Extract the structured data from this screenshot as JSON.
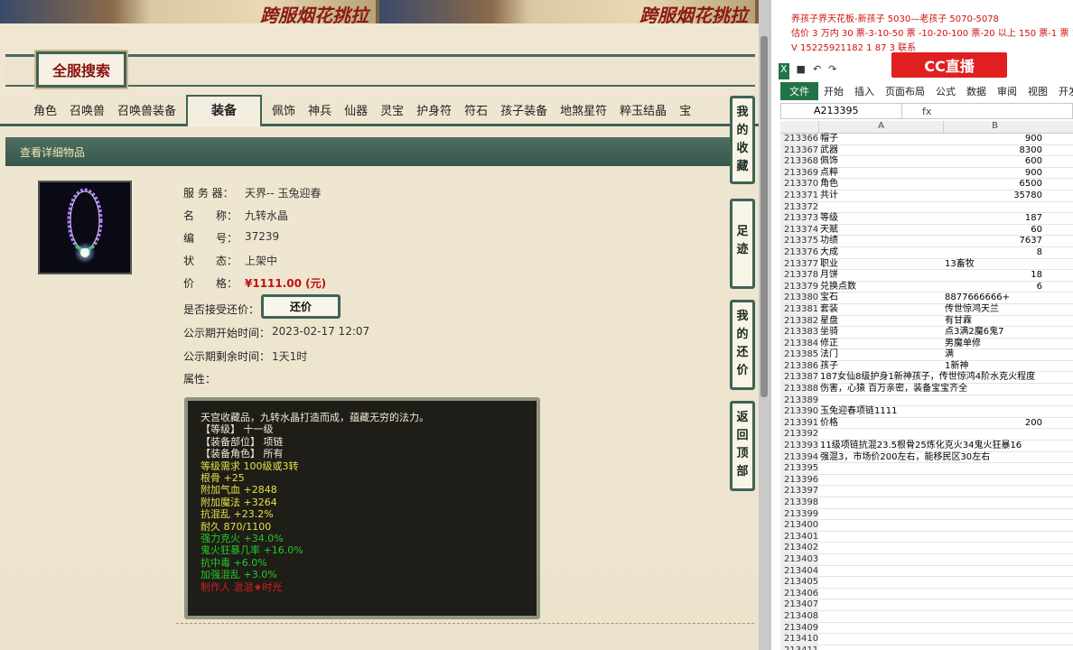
{
  "banner": {
    "text": "跨服烟花挑拉"
  },
  "search": {
    "title": "全服搜索"
  },
  "tabs": [
    "角色",
    "召唤兽",
    "召唤兽装备",
    "装备",
    "佩饰",
    "神兵",
    "仙器",
    "灵宝",
    "护身符",
    "符石",
    "孩子装备",
    "地煞星符",
    "粹玉结晶",
    "宝"
  ],
  "active_tab": "装备",
  "detail": {
    "bar_label": "查看详细物品",
    "fields": [
      {
        "label": "服 务 器：",
        "value": "天界-- 玉兔迎春"
      },
      {
        "label": "名　　称：",
        "value": "九转水晶"
      },
      {
        "label": "编　　号：",
        "value": "37239"
      },
      {
        "label": "状　　态：",
        "value": "上架中"
      },
      {
        "label": "价　　格：",
        "value": "¥1111.00 (元)"
      }
    ],
    "haggle_label": "是否接受还价：",
    "haggle_button": "还价",
    "pub_start_label": "公示期开始时间：",
    "pub_start_value": "2023-02-17 12:07",
    "pub_left_label": "公示期剩余时间：",
    "pub_left_value": "1天1时",
    "attr_label": "属性："
  },
  "attributes": [
    {
      "text": "天宫收藏品，九转水晶打造而成，蕴藏无穷的法力。",
      "color": "white"
    },
    {
      "text": "【等级】 十一级",
      "color": "white"
    },
    {
      "text": "【装备部位】 项链",
      "color": "white"
    },
    {
      "text": "【装备角色】 所有",
      "color": "white"
    },
    {
      "text": "等级需求 100级或3转",
      "color": "yellow"
    },
    {
      "text": "根骨 +25",
      "color": "yellow"
    },
    {
      "text": "附加气血 +2848",
      "color": "yellow"
    },
    {
      "text": "附加魔法 +3264",
      "color": "yellow"
    },
    {
      "text": "抗混乱 +23.2%",
      "color": "yellow"
    },
    {
      "text": "耐久 870/1100",
      "color": "yellow"
    },
    {
      "text": "强力克火 +34.0%",
      "color": "green"
    },
    {
      "text": "鬼火狂暴几率 +16.0%",
      "color": "green"
    },
    {
      "text": "抗中毒 +6.0%",
      "color": "green"
    },
    {
      "text": "加强混乱 +3.0%",
      "color": "green"
    },
    {
      "text": "制作人 混混★时光",
      "color": "red"
    }
  ],
  "side_buttons": [
    {
      "label": "我的收藏"
    },
    {
      "label": "足迹"
    },
    {
      "label": "我的还价"
    },
    {
      "label": "返回顶部"
    }
  ],
  "ad": {
    "line1": "养孩子界天花板-新孩子 5030—老孩子 5070-5078",
    "line2": "估价 3 万内 30 票-3-10-50 票 -10-20-100 票-20 以上 150 票-1 票 1",
    "line3": "V 15225921182   1 87      3      联系"
  },
  "cc_logo": "CC直播",
  "excel": {
    "ribbon_tabs": [
      "文件",
      "开始",
      "插入",
      "页面布局",
      "公式",
      "数据",
      "审阅",
      "视图",
      "开发工"
    ],
    "namebox": "A213395",
    "fx": "fx",
    "col_a": "A",
    "col_b": "B",
    "rows": [
      {
        "n": "213366",
        "a": "帽子",
        "b": "900"
      },
      {
        "n": "213367",
        "a": "武器",
        "b": "8300"
      },
      {
        "n": "213368",
        "a": "佩饰",
        "b": "600"
      },
      {
        "n": "213369",
        "a": "点粹",
        "b": "900"
      },
      {
        "n": "213370",
        "a": "角色",
        "b": "6500"
      },
      {
        "n": "213371",
        "a": "共计",
        "b": "35780"
      },
      {
        "n": "213372",
        "a": "",
        "b": ""
      },
      {
        "n": "213373",
        "a": "等级",
        "b": "187"
      },
      {
        "n": "213374",
        "a": "天赋",
        "b": "60"
      },
      {
        "n": "213375",
        "a": "功绩",
        "b": "7637"
      },
      {
        "n": "213376",
        "a": "大成",
        "b": "8"
      },
      {
        "n": "213377",
        "a": "职业",
        "b": "13畜牧",
        "bl": true
      },
      {
        "n": "213378",
        "a": "月饼",
        "b": "18"
      },
      {
        "n": "213379",
        "a": "兑换点数",
        "b": "6"
      },
      {
        "n": "213380",
        "a": "宝石",
        "b": "8877666666+",
        "bl": true
      },
      {
        "n": "213381",
        "a": "套装",
        "b": "传世惊鸿天兰",
        "bl": true
      },
      {
        "n": "213382",
        "a": "星盘",
        "b": "有甘霖",
        "bl": true
      },
      {
        "n": "213383",
        "a": "坐骑",
        "b": "点3满2魔6鬼7",
        "bl": true
      },
      {
        "n": "213384",
        "a": "修正",
        "b": "男魔单修",
        "bl": true
      },
      {
        "n": "213385",
        "a": "法门",
        "b": "满",
        "bl": true
      },
      {
        "n": "213386",
        "a": "孩子",
        "b": "1新神",
        "bl": true
      },
      {
        "n": "213387",
        "a": "187女仙8级护身1新神孩子，传世惊鸿4阶水克火程度",
        "b": ""
      },
      {
        "n": "213388",
        "a": "伤害，心猿 百万亲密，装备宝宝齐全",
        "b": ""
      },
      {
        "n": "213389",
        "a": "",
        "b": ""
      },
      {
        "n": "213390",
        "a": "玉兔迎春项链1111",
        "b": ""
      },
      {
        "n": "213391",
        "a": "价格",
        "b": "200"
      },
      {
        "n": "213392",
        "a": "",
        "b": ""
      },
      {
        "n": "213393",
        "a": "11级项链抗混23.5根骨25炼化克火34鬼火狂暴16",
        "b": ""
      },
      {
        "n": "213394",
        "a": "强混3，市场价200左右，能移民区30左右",
        "b": ""
      },
      {
        "n": "213395",
        "a": "",
        "b": ""
      },
      {
        "n": "213396",
        "a": "",
        "b": ""
      },
      {
        "n": "213397",
        "a": "",
        "b": ""
      },
      {
        "n": "213398",
        "a": "",
        "b": ""
      },
      {
        "n": "213399",
        "a": "",
        "b": ""
      },
      {
        "n": "213400",
        "a": "",
        "b": ""
      },
      {
        "n": "213401",
        "a": "",
        "b": ""
      },
      {
        "n": "213402",
        "a": "",
        "b": ""
      },
      {
        "n": "213403",
        "a": "",
        "b": ""
      },
      {
        "n": "213404",
        "a": "",
        "b": ""
      },
      {
        "n": "213405",
        "a": "",
        "b": ""
      },
      {
        "n": "213406",
        "a": "",
        "b": ""
      },
      {
        "n": "213407",
        "a": "",
        "b": ""
      },
      {
        "n": "213408",
        "a": "",
        "b": ""
      },
      {
        "n": "213409",
        "a": "",
        "b": ""
      },
      {
        "n": "213410",
        "a": "",
        "b": ""
      },
      {
        "n": "213411",
        "a": "",
        "b": ""
      }
    ]
  }
}
